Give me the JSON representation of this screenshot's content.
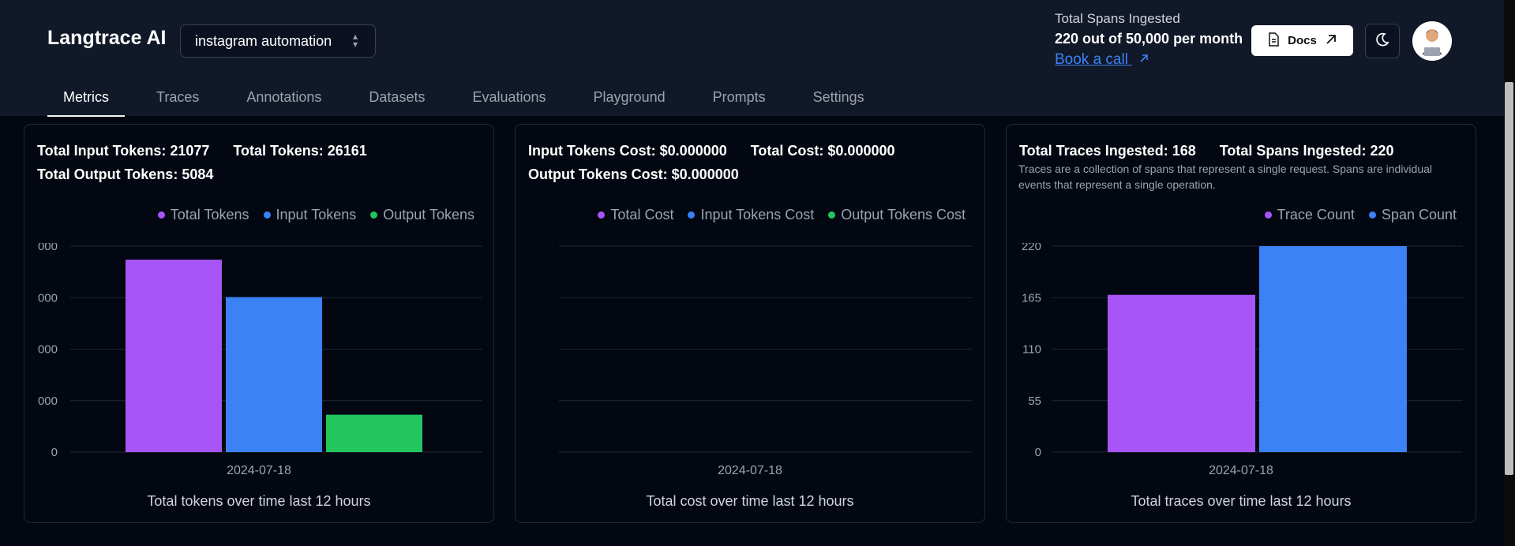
{
  "header": {
    "logo": "Langtrace AI",
    "project": "instagram automation",
    "usage": {
      "title": "Total Spans Ingested",
      "value": "220 out of 50,000 per month",
      "link": "Book a call"
    },
    "docs_label": "Docs"
  },
  "tabs": [
    {
      "label": "Metrics",
      "active": true
    },
    {
      "label": "Traces"
    },
    {
      "label": "Annotations"
    },
    {
      "label": "Datasets"
    },
    {
      "label": "Evaluations"
    },
    {
      "label": "Playground"
    },
    {
      "label": "Prompts"
    },
    {
      "label": "Settings"
    }
  ],
  "cards": [
    {
      "stats": [
        [
          "Total Input Tokens: 21077",
          "Total Tokens: 26161"
        ],
        [
          "Total Output Tokens: 5084"
        ]
      ],
      "description": "",
      "legend": [
        {
          "label": "Total Tokens",
          "color": "#a855f7"
        },
        {
          "label": "Input Tokens",
          "color": "#3b82f6"
        },
        {
          "label": "Output Tokens",
          "color": "#22c55e"
        }
      ],
      "x_label": "2024-07-18",
      "caption": "Total tokens over time last 12 hours"
    },
    {
      "stats": [
        [
          "Input Tokens Cost: $0.000000",
          "Total Cost: $0.000000"
        ],
        [
          "Output Tokens Cost: $0.000000"
        ]
      ],
      "description": "",
      "legend": [
        {
          "label": "Total Cost",
          "color": "#a855f7"
        },
        {
          "label": "Input Tokens Cost",
          "color": "#3b82f6"
        },
        {
          "label": "Output Tokens Cost",
          "color": "#22c55e"
        }
      ],
      "x_label": "2024-07-18",
      "caption": "Total cost over time last 12 hours"
    },
    {
      "stats": [
        [
          "Total Traces Ingested: 168",
          "Total Spans Ingested: 220"
        ]
      ],
      "description": "Traces are a collection of spans that represent a single request. Spans are individual events that represent a single operation.",
      "legend": [
        {
          "label": "Trace Count",
          "color": "#a855f7"
        },
        {
          "label": "Span Count",
          "color": "#3b82f6"
        }
      ],
      "x_label": "2024-07-18",
      "caption": "Total traces over time last 12 hours"
    }
  ],
  "chart_data": [
    {
      "type": "bar",
      "categories": [
        "2024-07-18"
      ],
      "series": [
        {
          "name": "Total Tokens",
          "values": [
            26161
          ]
        },
        {
          "name": "Input Tokens",
          "values": [
            21077
          ]
        },
        {
          "name": "Output Tokens",
          "values": [
            5084
          ]
        }
      ],
      "ytick_labels": [
        "0",
        "000",
        "000",
        "000",
        "000"
      ],
      "ylim": [
        0,
        28000
      ],
      "grid": true,
      "legend": "top-right"
    },
    {
      "type": "bar",
      "categories": [
        "2024-07-18"
      ],
      "series": [
        {
          "name": "Total Cost",
          "values": [
            0
          ]
        },
        {
          "name": "Input Tokens Cost",
          "values": [
            0
          ]
        },
        {
          "name": "Output Tokens Cost",
          "values": [
            0
          ]
        }
      ],
      "ytick_labels": [],
      "ylim": [
        0,
        1
      ],
      "grid": true,
      "legend": "top-right"
    },
    {
      "type": "bar",
      "categories": [
        "2024-07-18"
      ],
      "series": [
        {
          "name": "Trace Count",
          "values": [
            168
          ]
        },
        {
          "name": "Span Count",
          "values": [
            220
          ]
        }
      ],
      "ytick_labels": [
        "0",
        "55",
        "110",
        "165",
        "220"
      ],
      "ylim": [
        0,
        220
      ],
      "grid": true,
      "legend": "top-right"
    }
  ]
}
